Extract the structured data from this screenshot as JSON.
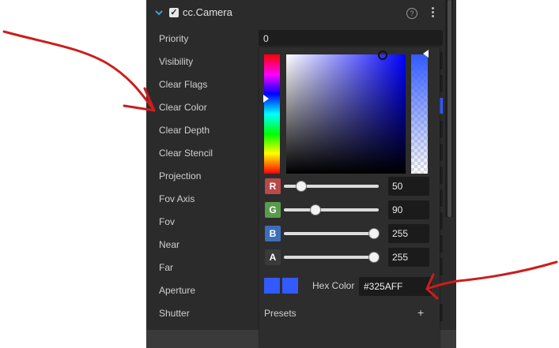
{
  "component": {
    "title": "cc.Camera",
    "help_symbol": "?",
    "checked": true
  },
  "properties": [
    {
      "label": "Priority"
    },
    {
      "label": "Visibility"
    },
    {
      "label": "Clear Flags"
    },
    {
      "label": "Clear Color"
    },
    {
      "label": "Clear Depth"
    },
    {
      "label": "Clear Stencil"
    },
    {
      "label": "Projection"
    },
    {
      "label": "Fov Axis"
    },
    {
      "label": "Fov"
    },
    {
      "label": "Near"
    },
    {
      "label": "Far"
    },
    {
      "label": "Aperture"
    },
    {
      "label": "Shutter"
    }
  ],
  "priority_value": "0",
  "color_picker": {
    "channels": [
      {
        "badge": "R",
        "value": "50",
        "level": 0.196,
        "color": "#b84a4a"
      },
      {
        "badge": "G",
        "value": "90",
        "level": 0.353,
        "color": "#5a9a4c"
      },
      {
        "badge": "B",
        "value": "255",
        "level": 1.0,
        "color": "#3d6fb8"
      },
      {
        "badge": "A",
        "value": "255",
        "level": 1.0,
        "color": "#3a3a3a"
      }
    ],
    "hex_label": "Hex Color",
    "hex_value": "#325AFF",
    "presets_label": "Presets",
    "presets_add": "+",
    "current_color": "#325AFF"
  },
  "icons": {
    "collapse": "chevron-down-icon",
    "help": "help-icon",
    "more": "more-vertical-icon",
    "add": "plus-icon"
  }
}
